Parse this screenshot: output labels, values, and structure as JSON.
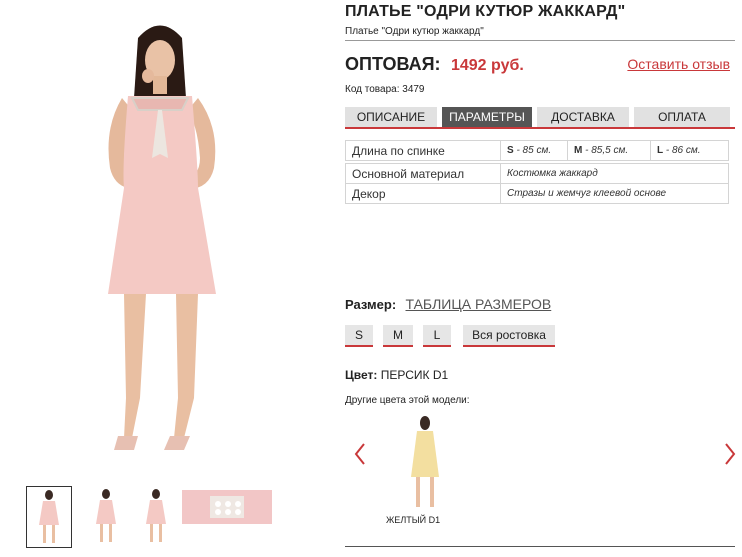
{
  "product": {
    "title": "ПЛАТЬЕ \"ОДРИ КУТЮР ЖАККАРД\"",
    "subtitle": "Платье \"Одри кутюр жаккард\"",
    "price_label": "ОПТОВАЯ:",
    "price_value": "1492 руб.",
    "review_link": "Оставить отзыв",
    "code": "Код товара: 3479"
  },
  "tabs": [
    "ОПИСАНИЕ",
    "ПАРАМЕТРЫ",
    "ДОСТАВКА",
    "ОПЛАТА"
  ],
  "params": {
    "length_label": "Длина по спинке",
    "length_s": "S",
    "length_s_val": "- 85 см.",
    "length_m": "M",
    "length_m_val": "- 85,5 см.",
    "length_l": "L",
    "length_l_val": "- 86 см.",
    "material_label": "Основной материал",
    "material_value": "Костюмка жаккард",
    "decor_label": "Декор",
    "decor_value": "Стразы и жемчуг клеевой основе"
  },
  "size": {
    "label": "Размер:",
    "table_link": "ТАБЛИЦА РАЗМЕРОВ",
    "options": [
      "S",
      "M",
      "L",
      "Вся ростовка"
    ]
  },
  "color": {
    "label": "Цвет:",
    "value": "ПЕРСИК D1",
    "other_label": "Другие цвета этой модели:",
    "other_item": "ЖЕЛТЫЙ D1"
  },
  "colors": {
    "accent": "#c9383a",
    "active_tab": "#555555",
    "dress_pink": "#f4c9c4",
    "dress_yellow": "#f3dfa0"
  }
}
